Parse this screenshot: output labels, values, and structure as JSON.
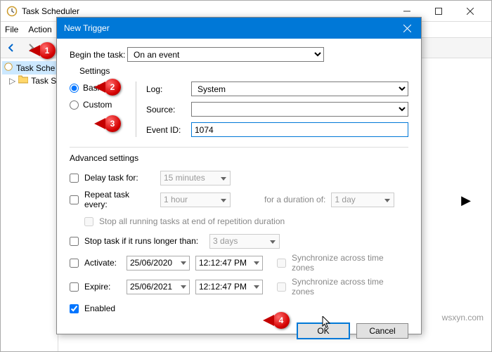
{
  "app": {
    "title": "Task Scheduler",
    "menu": [
      "File",
      "Action"
    ],
    "tree": {
      "root": "Task Sche",
      "child": "Task S"
    }
  },
  "dialog": {
    "title": "New Trigger",
    "begin_label": "Begin the task:",
    "begin_value": "On an event",
    "settings_label": "Settings",
    "basic_label": "Basic",
    "custom_label": "Custom",
    "log_label": "Log:",
    "log_value": "System",
    "source_label": "Source:",
    "source_value": "",
    "eventid_label": "Event ID:",
    "eventid_value": "1074",
    "adv_title": "Advanced settings",
    "delay_label": "Delay task for:",
    "delay_value": "15 minutes",
    "repeat_label": "Repeat task every:",
    "repeat_value": "1 hour",
    "duration_label": "for a duration of:",
    "duration_value": "1 day",
    "stoprep_label": "Stop all running tasks at end of repetition duration",
    "stoplong_label": "Stop task if it runs longer than:",
    "stoplong_value": "3 days",
    "activate_label": "Activate:",
    "activate_date": "25/06/2020",
    "activate_time": "12:12:47 PM",
    "expire_label": "Expire:",
    "expire_date": "25/06/2021",
    "expire_time": "12:12:47 PM",
    "sync_label": "Synchronize across time zones",
    "enabled_label": "Enabled",
    "ok": "OK",
    "cancel": "Cancel"
  },
  "callouts": {
    "c1": "1",
    "c2": "2",
    "c3": "3",
    "c4": "4"
  },
  "watermark": "wsxyn.com"
}
